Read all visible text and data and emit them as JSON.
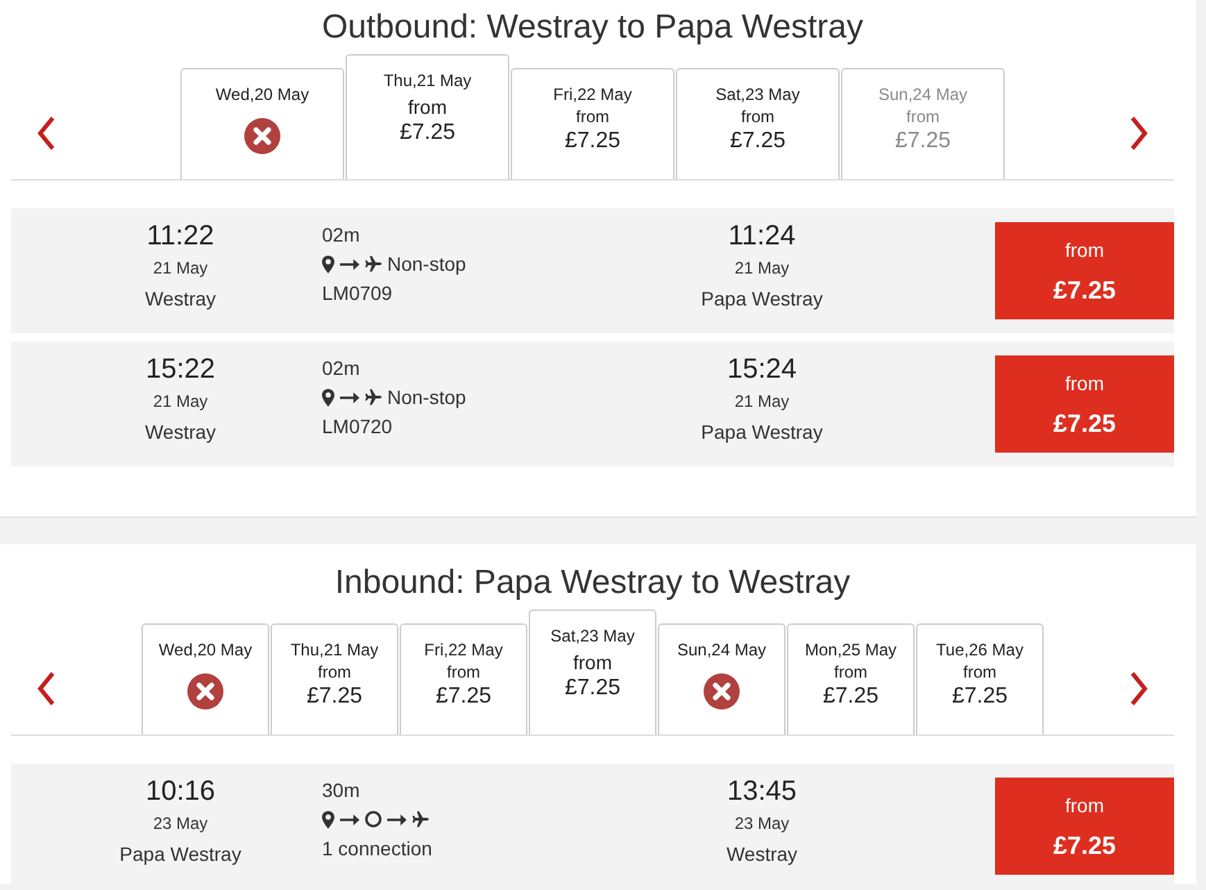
{
  "outbound": {
    "title": "Outbound: Westray to Papa Westray",
    "dates": [
      {
        "kind": "no-flights",
        "label": "Wed,20 May",
        "selected": false,
        "disabled": false
      },
      {
        "kind": "fare",
        "label": "Thu,21 May",
        "from": "from",
        "price": "£7.25",
        "selected": true,
        "disabled": false
      },
      {
        "kind": "fare",
        "label": "Fri,22 May",
        "from": "from",
        "price": "£7.25",
        "selected": false,
        "disabled": false
      },
      {
        "kind": "fare",
        "label": "Sat,23 May",
        "from": "from",
        "price": "£7.25",
        "selected": false,
        "disabled": false
      },
      {
        "kind": "fare",
        "label": "Sun,24 May",
        "from": "from",
        "price": "£7.25",
        "selected": false,
        "disabled": true
      }
    ],
    "flights": [
      {
        "kind": "direct",
        "depart_time": "11:22",
        "depart_date": "21 May",
        "depart_place": "Westray",
        "duration": "02m",
        "stops": "Non-stop",
        "flight_number": "LM0709",
        "arrive_time": "11:24",
        "arrive_date": "21 May",
        "arrive_place": "Papa Westray",
        "fare_label": "from",
        "fare": "£7.25"
      },
      {
        "kind": "direct",
        "depart_time": "15:22",
        "depart_date": "21 May",
        "depart_place": "Westray",
        "duration": "02m",
        "stops": "Non-stop",
        "flight_number": "LM0720",
        "arrive_time": "15:24",
        "arrive_date": "21 May",
        "arrive_place": "Papa Westray",
        "fare_label": "from",
        "fare": "£7.25"
      }
    ]
  },
  "inbound": {
    "title": "Inbound: Papa Westray to Westray",
    "dates": [
      {
        "kind": "no-flights",
        "label": "Wed,20 May",
        "selected": false,
        "disabled": false
      },
      {
        "kind": "fare",
        "label": "Thu,21 May",
        "from": "from",
        "price": "£7.25",
        "selected": false,
        "disabled": false
      },
      {
        "kind": "fare",
        "label": "Fri,22 May",
        "from": "from",
        "price": "£7.25",
        "selected": false,
        "disabled": false
      },
      {
        "kind": "fare",
        "label": "Sat,23 May",
        "from": "from",
        "price": "£7.25",
        "selected": true,
        "disabled": false
      },
      {
        "kind": "no-flights",
        "label": "Sun,24 May",
        "selected": false,
        "disabled": false
      },
      {
        "kind": "fare",
        "label": "Mon,25 May",
        "from": "from",
        "price": "£7.25",
        "selected": false,
        "disabled": false
      },
      {
        "kind": "fare",
        "label": "Tue,26 May",
        "from": "from",
        "price": "£7.25",
        "selected": false,
        "disabled": false
      }
    ],
    "flights": [
      {
        "kind": "connecting",
        "depart_time": "10:16",
        "depart_date": "23 May",
        "depart_place": "Papa Westray",
        "duration": "30m",
        "stops": "1 connection",
        "arrive_time": "13:45",
        "arrive_date": "23 May",
        "arrive_place": "Westray",
        "fare_label": "from",
        "fare": "£7.25"
      }
    ]
  }
}
